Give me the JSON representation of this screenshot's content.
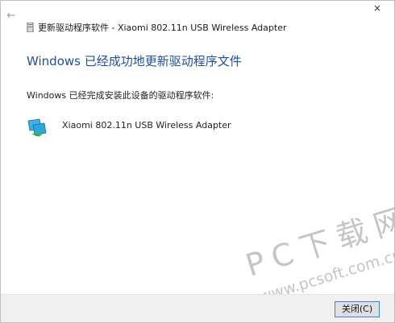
{
  "window": {
    "title": "更新驱动程序软件 - Xiaomi 802.11n USB Wireless Adapter",
    "back_icon": "back-arrow-icon",
    "close_icon": "close-icon",
    "close_glyph": "×"
  },
  "content": {
    "heading": "Windows 已经成功地更新驱动程序文件",
    "description": "Windows 已经完成安装此设备的驱动程序软件:",
    "device_name": "Xiaomi 802.11n USB Wireless Adapter",
    "device_icon": "network-adapter-icon"
  },
  "footer": {
    "close_label": "关闭(C)"
  },
  "watermark": {
    "brand": "PC下载网",
    "url": "www.pcsoft.com.cn"
  },
  "colors": {
    "heading": "#1e4fa8",
    "button_border": "#3c7fd6",
    "footer_bg": "#f0f0f0"
  }
}
